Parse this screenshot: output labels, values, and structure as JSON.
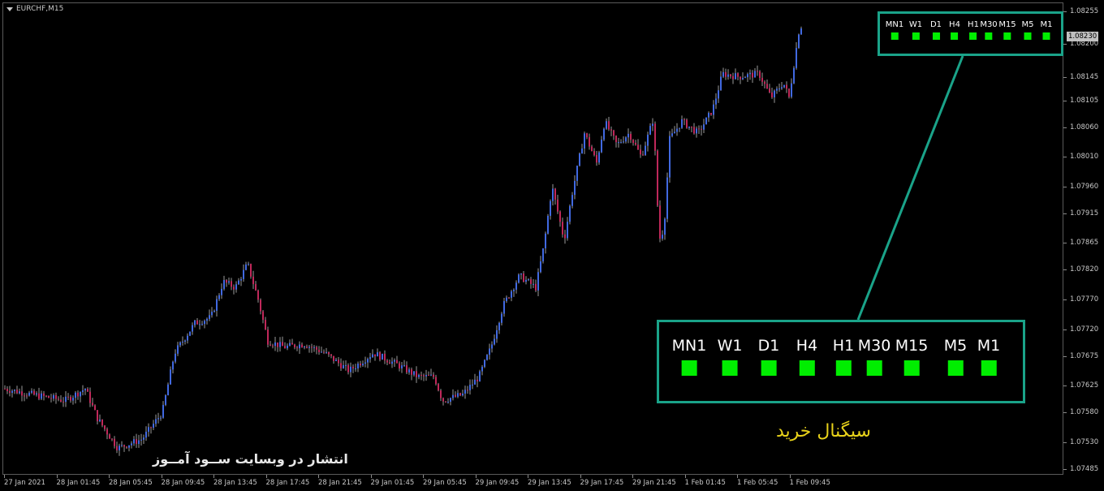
{
  "chart": {
    "symbol_timeframe": "EURCHF,M15",
    "current_price": "1.08230",
    "price_levels": [
      "1.08255",
      "1.08200",
      "1.08145",
      "1.08105",
      "1.08060",
      "1.08010",
      "1.07960",
      "1.07915",
      "1.07865",
      "1.07820",
      "1.07770",
      "1.07720",
      "1.07675",
      "1.07625",
      "1.07580",
      "1.07530",
      "1.07485"
    ],
    "time_labels": [
      "27 Jan 2021",
      "28 Jan 01:45",
      "28 Jan 05:45",
      "28 Jan 09:45",
      "28 Jan 13:45",
      "28 Jan 17:45",
      "28 Jan 21:45",
      "29 Jan 01:45",
      "29 Jan 05:45",
      "29 Jan 09:45",
      "29 Jan 13:45",
      "29 Jan 17:45",
      "29 Jan 21:45",
      "1 Feb 01:45",
      "1 Feb 05:45",
      "1 Feb 09:45"
    ],
    "colors": {
      "bull": "#4169e1",
      "bear": "#c0285a",
      "panel_border": "#1aa389",
      "signal_square": "#00ee00",
      "buy_text": "#e8d21a"
    },
    "price_min": 1.07475,
    "price_max": 1.0827
  },
  "indicator": {
    "timeframes": [
      "MN1",
      "W1",
      "D1",
      "H4",
      "H1",
      "M30",
      "M15",
      "M5",
      "M1"
    ],
    "signal_color": "#00ee00"
  },
  "annotations": {
    "buy_signal": "سیگنال خرید",
    "watermark": "انتشار در وبسایت ســود آمــوز"
  }
}
